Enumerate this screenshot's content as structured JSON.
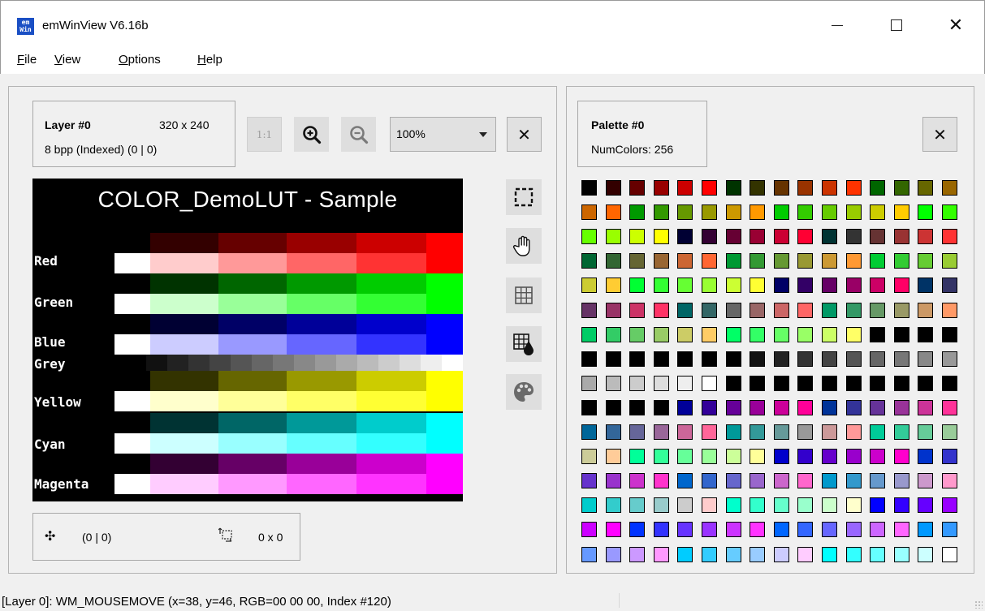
{
  "window": {
    "title": "emWinView V6.16b",
    "app_icon_text": "em\nWin",
    "controls": {
      "minimize": "minimize",
      "maximize": "maximize",
      "close": "close"
    }
  },
  "menu": [
    {
      "label": "File",
      "accel": "F",
      "rest": "ile"
    },
    {
      "label": "View",
      "accel": "V",
      "rest": "iew"
    },
    {
      "label": "Options",
      "accel": "O",
      "rest": "ptions"
    },
    {
      "label": "Help",
      "accel": "H",
      "rest": "elp"
    }
  ],
  "layer": {
    "name": "Layer #0",
    "size": "320 x 240",
    "info": "8 bpp (Indexed)  (0 | 0)"
  },
  "toolbar": {
    "one_to_one": "1:1",
    "zoom_value": "100%",
    "icons": [
      "zoom-in-icon",
      "zoom-out-icon",
      "close-icon"
    ]
  },
  "canvas": {
    "title": "COLOR_DemoLUT - Sample",
    "rows": [
      {
        "label": "Red",
        "base": "#ff0000"
      },
      {
        "label": "Green",
        "base": "#00ff00"
      },
      {
        "label": "Blue",
        "base": "#0000ff"
      },
      {
        "label": "Grey",
        "base": "#ffffff"
      },
      {
        "label": "Yellow",
        "base": "#ffff00"
      },
      {
        "label": "Cyan",
        "base": "#00ffff"
      },
      {
        "label": "Magenta",
        "base": "#ff00ff"
      }
    ]
  },
  "side_tools": [
    "selection-icon",
    "hand-pan-icon",
    "grid-icon",
    "grid-color-icon",
    "palette-icon"
  ],
  "bottom_info": {
    "move_icon": "move-icon",
    "position": "(0 | 0)",
    "selection_icon": "selection-size-icon",
    "selection_size": "0 x 0"
  },
  "palette": {
    "name": "Palette #0",
    "num_colors": "NumColors: 256",
    "close_icon": "close-icon",
    "colors": [
      "#000000",
      "#330000",
      "#660000",
      "#990000",
      "#cc0000",
      "#ff0000",
      "#003300",
      "#333300",
      "#663300",
      "#993300",
      "#cc3300",
      "#ff3300",
      "#006600",
      "#336600",
      "#666600",
      "#996600",
      "#cc6600",
      "#ff6600",
      "#009900",
      "#339900",
      "#669900",
      "#999900",
      "#cc9900",
      "#ff9900",
      "#00cc00",
      "#33cc00",
      "#66cc00",
      "#99cc00",
      "#cccc00",
      "#ffcc00",
      "#00ff00",
      "#33ff00",
      "#66ff00",
      "#99ff00",
      "#ccff00",
      "#ffff00",
      "#000033",
      "#330033",
      "#660033",
      "#990033",
      "#cc0033",
      "#ff0033",
      "#003333",
      "#333333",
      "#663333",
      "#993333",
      "#cc3333",
      "#ff3333",
      "#006633",
      "#336633",
      "#666633",
      "#996633",
      "#cc6633",
      "#ff6633",
      "#009933",
      "#339933",
      "#669933",
      "#999933",
      "#cc9933",
      "#ff9933",
      "#00cc33",
      "#33cc33",
      "#66cc33",
      "#99cc33",
      "#cccc33",
      "#ffcc33",
      "#00ff33",
      "#33ff33",
      "#66ff33",
      "#99ff33",
      "#ccff33",
      "#ffff33",
      "#000066",
      "#330066",
      "#660066",
      "#990066",
      "#cc0066",
      "#ff0066",
      "#003366",
      "#333366",
      "#663366",
      "#993366",
      "#cc3366",
      "#ff3366",
      "#006666",
      "#336666",
      "#666666",
      "#996666",
      "#cc6666",
      "#ff6666",
      "#009966",
      "#339966",
      "#669966",
      "#999966",
      "#cc9966",
      "#ff9966",
      "#00cc66",
      "#33cc66",
      "#66cc66",
      "#99cc66",
      "#cccc66",
      "#ffcc66",
      "#00ff66",
      "#33ff66",
      "#66ff66",
      "#99ff66",
      "#ccff66",
      "#ffff66",
      "#000000",
      "#000000",
      "#000000",
      "#000000",
      "#000000",
      "#000000",
      "#000000",
      "#000000",
      "#000000",
      "#000000",
      "#000000",
      "#111111",
      "#222222",
      "#333333",
      "#444444",
      "#555555",
      "#666666",
      "#777777",
      "#888888",
      "#999999",
      "#aaaaaa",
      "#bbbbbb",
      "#cccccc",
      "#dddddd",
      "#eeeeee",
      "#ffffff",
      "#000000",
      "#000000",
      "#000000",
      "#000000",
      "#000000",
      "#000000",
      "#000000",
      "#000000",
      "#000000",
      "#000000",
      "#000000",
      "#000000",
      "#000000",
      "#000000",
      "#000099",
      "#330099",
      "#660099",
      "#990099",
      "#cc0099",
      "#ff0099",
      "#003399",
      "#333399",
      "#663399",
      "#993399",
      "#cc3399",
      "#ff3399",
      "#006699",
      "#336699",
      "#666699",
      "#996699",
      "#cc6699",
      "#ff6699",
      "#009999",
      "#339999",
      "#669999",
      "#999999",
      "#cc9999",
      "#ff9999",
      "#00cc99",
      "#33cc99",
      "#66cc99",
      "#99cc99",
      "#cccc99",
      "#ffcc99",
      "#00ff99",
      "#33ff99",
      "#66ff99",
      "#99ff99",
      "#ccff99",
      "#ffff99",
      "#0000cc",
      "#3300cc",
      "#6600cc",
      "#9900cc",
      "#cc00cc",
      "#ff00cc",
      "#0033cc",
      "#3333cc",
      "#6633cc",
      "#9933cc",
      "#cc33cc",
      "#ff33cc",
      "#0066cc",
      "#3366cc",
      "#6666cc",
      "#9966cc",
      "#cc66cc",
      "#ff66cc",
      "#0099cc",
      "#3399cc",
      "#6699cc",
      "#9999cc",
      "#cc99cc",
      "#ff99cc",
      "#00cccc",
      "#33cccc",
      "#66cccc",
      "#99cccc",
      "#cccccc",
      "#ffcccc",
      "#00ffcc",
      "#33ffcc",
      "#66ffcc",
      "#99ffcc",
      "#ccffcc",
      "#ffffcc",
      "#0000ff",
      "#3300ff",
      "#6600ff",
      "#9900ff",
      "#cc00ff",
      "#ff00ff",
      "#0033ff",
      "#3333ff",
      "#6633ff",
      "#9933ff",
      "#cc33ff",
      "#ff33ff",
      "#0066ff",
      "#3366ff",
      "#6666ff",
      "#9966ff",
      "#cc66ff",
      "#ff66ff",
      "#0099ff",
      "#3399ff",
      "#6699ff",
      "#9999ff",
      "#cc99ff",
      "#ff99ff",
      "#00ccff",
      "#33ccff",
      "#66ccff",
      "#99ccff",
      "#ccccff",
      "#ffccff",
      "#00ffff",
      "#33ffff",
      "#66ffff",
      "#99ffff",
      "#ccffff",
      "#ffffff"
    ]
  },
  "status": {
    "text": "[Layer 0]: WM_MOUSEMOVE (x=38, y=46, RGB=00 00 00, Index #120)"
  }
}
